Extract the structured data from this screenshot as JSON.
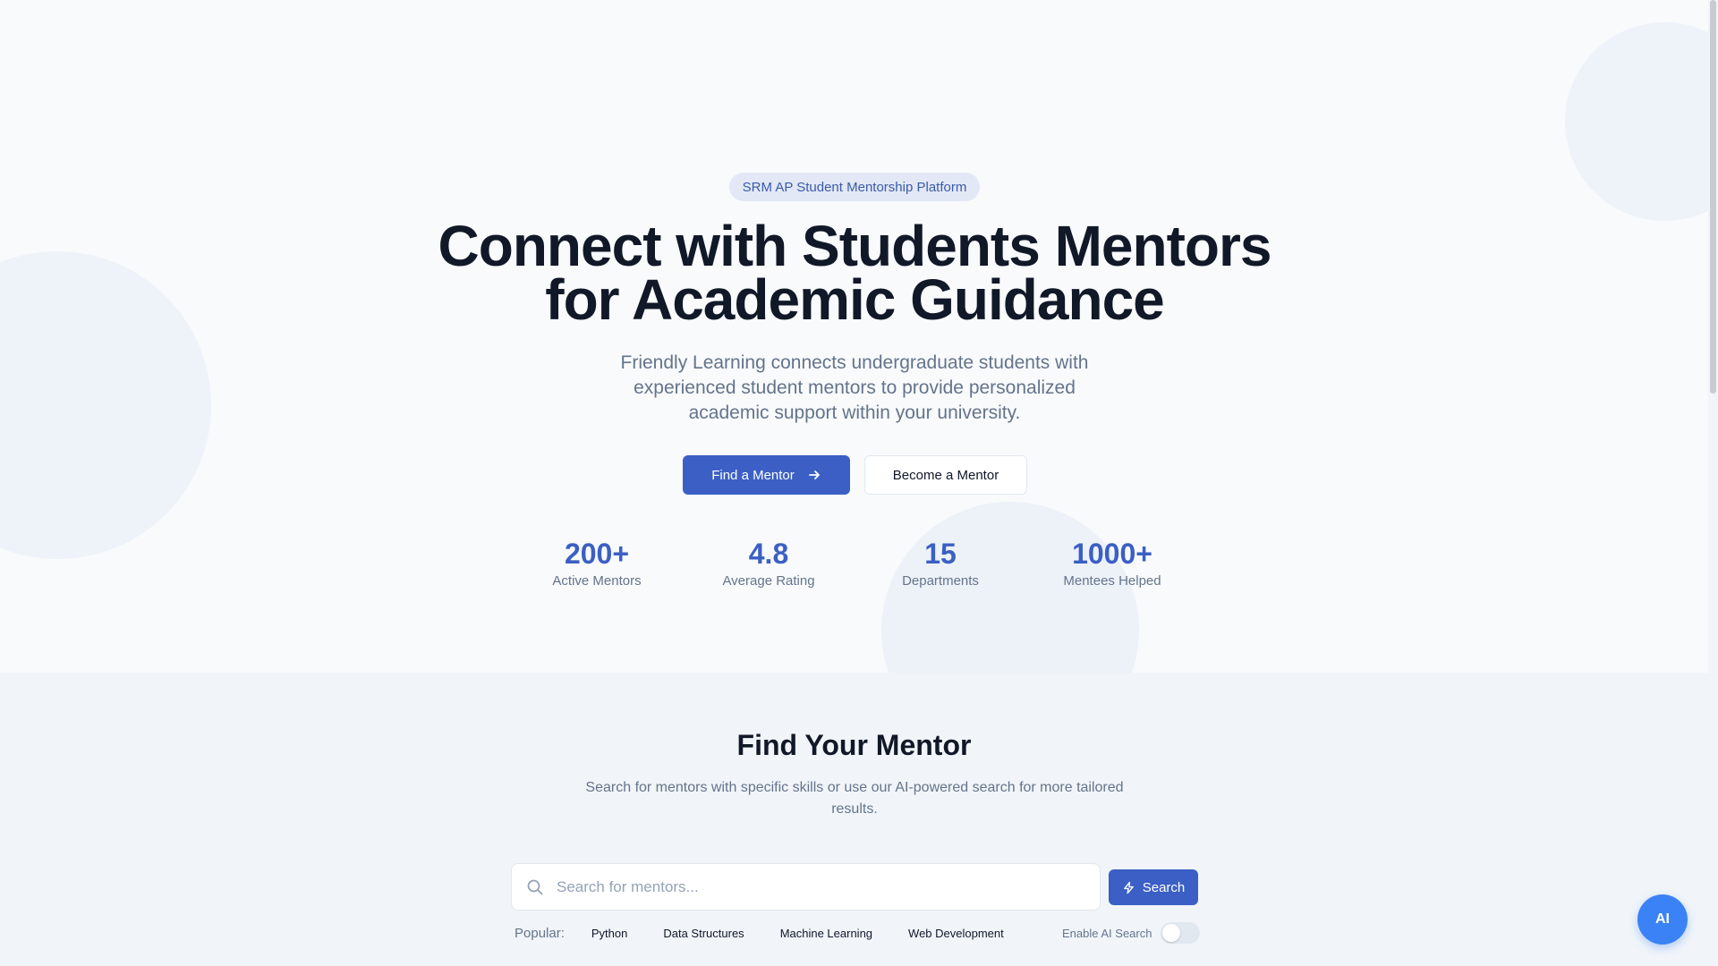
{
  "hero": {
    "badge": "SRM AP Student Mentorship Platform",
    "title_line1": "Connect with Students Mentors",
    "title_line2": "for Academic Guidance",
    "subtitle": "Friendly Learning connects undergraduate students with experienced student mentors to provide personalized academic support within your university.",
    "primary_button": "Find a Mentor",
    "primary_button_icon": "arrow-right-icon",
    "secondary_button": "Become a Mentor",
    "stats": [
      {
        "value": "200+",
        "label": "Active Mentors"
      },
      {
        "value": "4.8",
        "label": "Average Rating"
      },
      {
        "value": "15",
        "label": "Departments"
      },
      {
        "value": "1000+",
        "label": "Mentees Helped"
      }
    ]
  },
  "search_section": {
    "title": "Find Your Mentor",
    "subtitle": "Search for mentors with specific skills or use our AI-powered search for more tailored results.",
    "search_placeholder": "Search for mentors...",
    "search_value": "",
    "search_button": "Search",
    "search_button_icon": "lightning-icon",
    "popular_label": "Popular:",
    "popular_tags": [
      "Python",
      "Data Structures",
      "Machine Learning",
      "Web Development"
    ],
    "ai_toggle_label": "Enable AI Search",
    "ai_toggle_on": false
  },
  "fab": {
    "label": "AI"
  },
  "colors": {
    "accent": "#3b5fc4",
    "fab": "#3b82f6",
    "background": "#f8fafc",
    "muted_text": "#64748b"
  }
}
